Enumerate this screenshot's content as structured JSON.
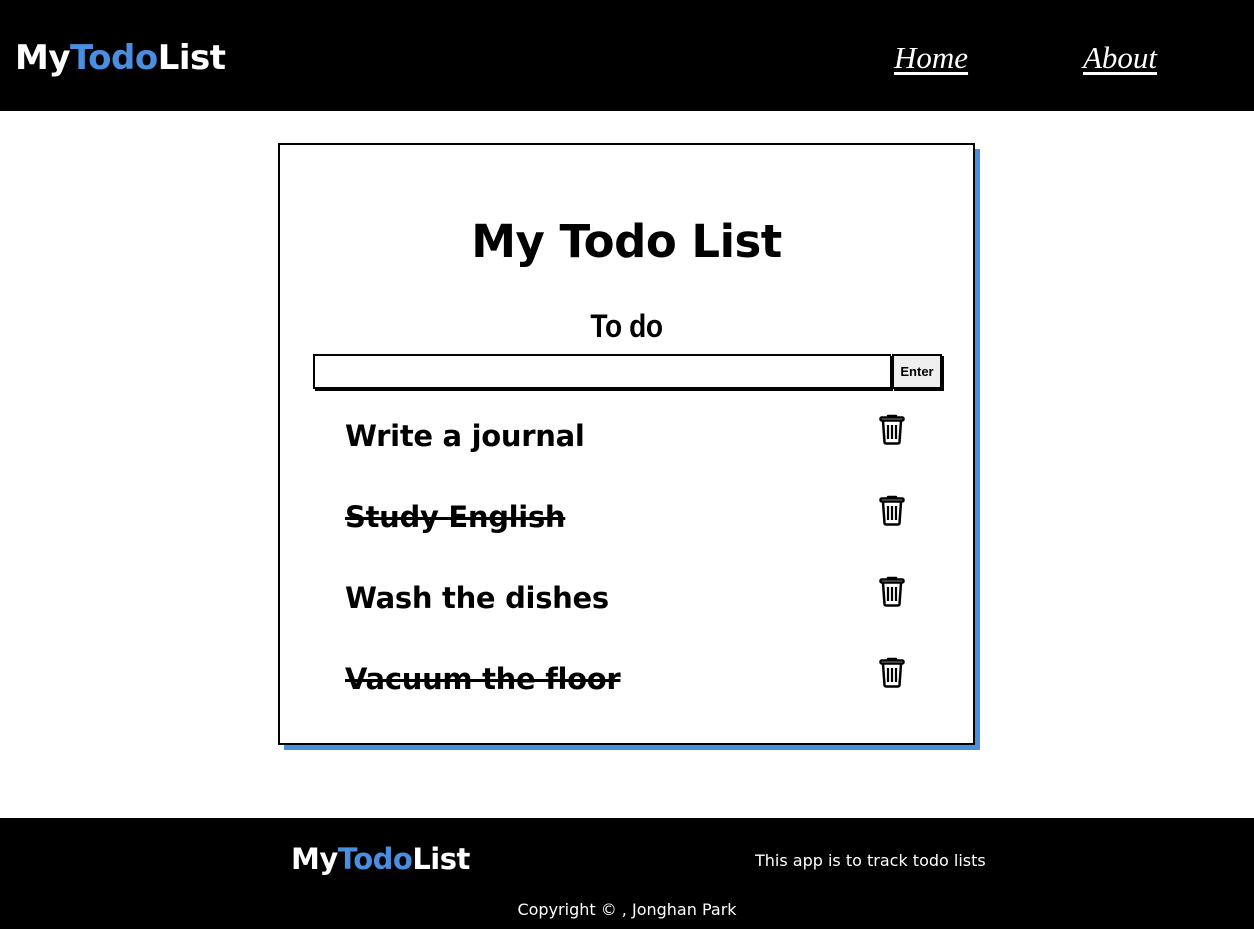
{
  "header": {
    "logo": {
      "part1": "My",
      "part2": "Todo",
      "part3": "List"
    },
    "nav": {
      "home": "Home",
      "about": "About"
    }
  },
  "colors": {
    "accent": "#4a8ee0",
    "header_bg": "#000000",
    "card_shadow": "#4a8ee0"
  },
  "card": {
    "title": "My Todo List",
    "section_label": "To do",
    "input": {
      "value": "",
      "placeholder": ""
    },
    "enter_label": "Enter",
    "todos": [
      {
        "text": "Write a journal",
        "done": false,
        "delete_icon": "trash-icon"
      },
      {
        "text": "Study English",
        "done": true,
        "delete_icon": "trash-icon"
      },
      {
        "text": "Wash the dishes",
        "done": false,
        "delete_icon": "trash-icon"
      },
      {
        "text": "Vacuum the floor",
        "done": true,
        "delete_icon": "trash-icon"
      }
    ]
  },
  "footer": {
    "logo": {
      "part1": "My",
      "part2": "Todo",
      "part3": "List"
    },
    "tagline": "This app is to track todo lists",
    "copyright": "Copyright © , Jonghan Park"
  }
}
